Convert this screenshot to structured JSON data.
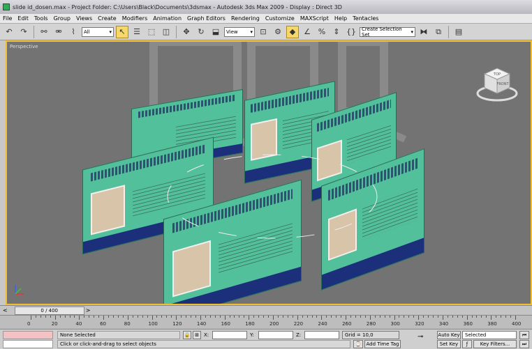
{
  "window": {
    "title": "slide id_dosen.max    - Project Folder: C:\\Users\\Black\\Documents\\3dsmax    - Autodesk 3ds Max  2009      - Display : Direct 3D"
  },
  "menu": [
    "File",
    "Edit",
    "Tools",
    "Group",
    "Views",
    "Create",
    "Modifiers",
    "Animation",
    "Graph Editors",
    "Rendering",
    "Customize",
    "MAXScript",
    "Help",
    "Tentacles"
  ],
  "toolbar": {
    "filter_value": "All",
    "view_value": "View",
    "named_selection_placeholder": "Create Selection Set"
  },
  "viewport": {
    "label": "Perspective",
    "viewcube": {
      "top": "TOP",
      "front": "FRONT"
    }
  },
  "timeline": {
    "frame_display": "0 / 400"
  },
  "ruler": {
    "ticks": [
      "0",
      "20",
      "40",
      "60",
      "80",
      "100",
      "120",
      "140",
      "160",
      "180",
      "200",
      "220",
      "240",
      "260",
      "280",
      "300",
      "320",
      "340",
      "360",
      "380",
      "400"
    ]
  },
  "status": {
    "selection": "None Selected",
    "prompt": "Click or click-and-drag to select objects",
    "x_label": "X:",
    "y_label": "Y:",
    "z_label": "Z:",
    "grid": "Grid = 10,0",
    "add_time_tag": "Add Time Tag",
    "auto_key": "Auto Key",
    "set_key": "Set Key",
    "key_mode_value": "Selected",
    "key_filters": "Key Filters..."
  },
  "accent": "#f0c030"
}
